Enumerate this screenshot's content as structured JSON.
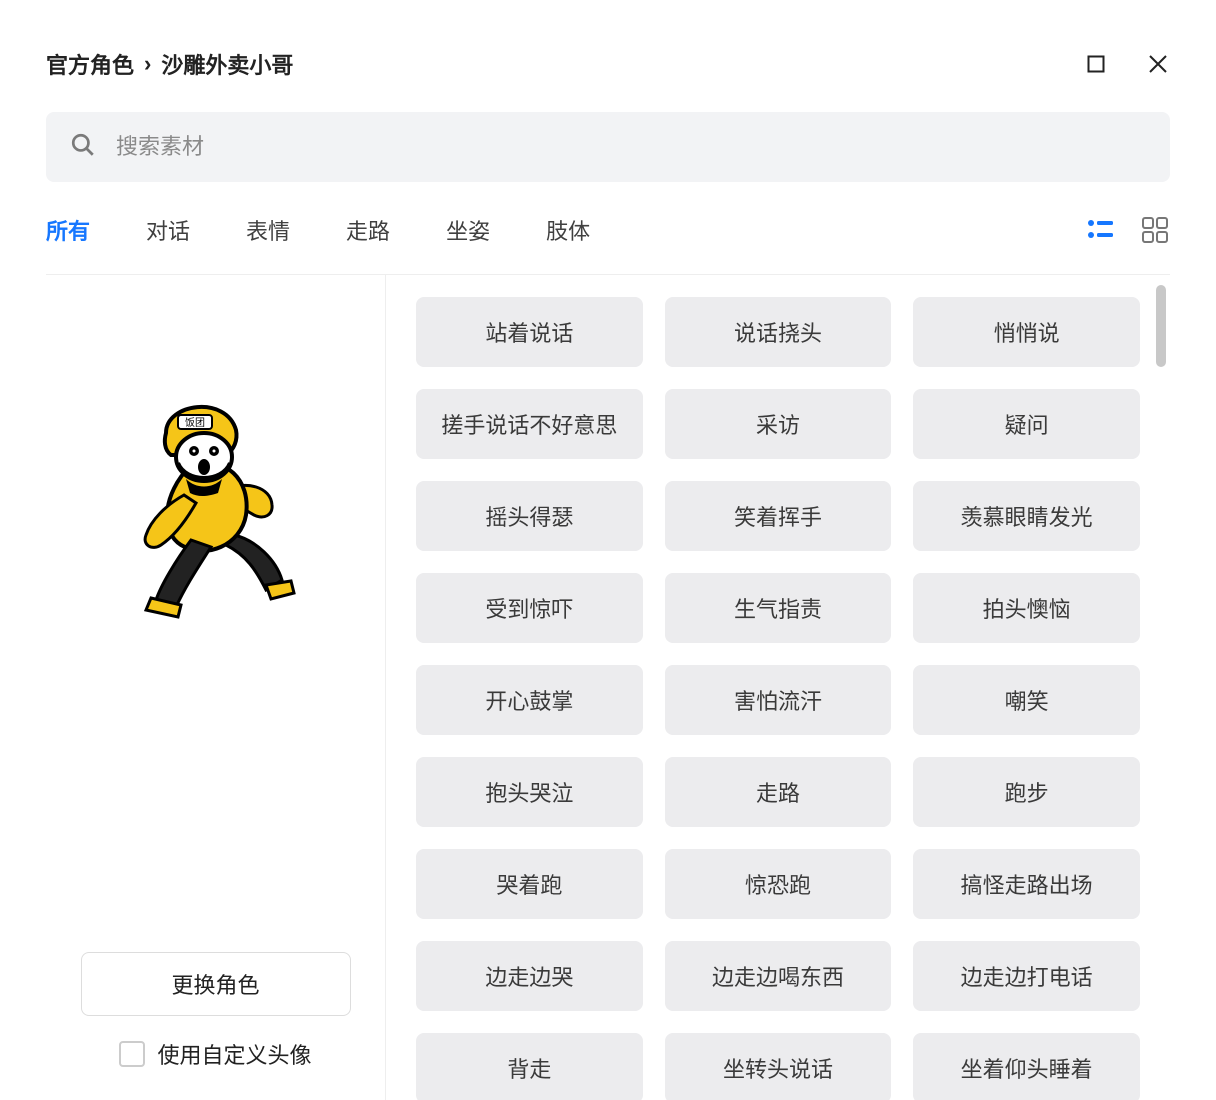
{
  "breadcrumb": {
    "parent": "官方角色",
    "sep": "›",
    "current": "沙雕外卖小哥"
  },
  "search": {
    "placeholder": "搜索素材"
  },
  "tabs": [
    {
      "label": "所有",
      "active": true
    },
    {
      "label": "对话",
      "active": false
    },
    {
      "label": "表情",
      "active": false
    },
    {
      "label": "走路",
      "active": false
    },
    {
      "label": "坐姿",
      "active": false
    },
    {
      "label": "肢体",
      "active": false
    }
  ],
  "colors": {
    "accent": "#1677ff",
    "tile_bg": "#ececee",
    "brand_yellow": "#f5c518"
  },
  "left": {
    "change_role_label": "更换角色",
    "checkbox_label": "使用自定义头像",
    "helmet_text": "饭团"
  },
  "assets": [
    "站着说话",
    "说话挠头",
    "悄悄说",
    "搓手说话不好意思",
    "采访",
    "疑问",
    "摇头得瑟",
    "笑着挥手",
    "羡慕眼睛发光",
    "受到惊吓",
    "生气指责",
    "拍头懊恼",
    "开心鼓掌",
    "害怕流汗",
    "嘲笑",
    "抱头哭泣",
    "走路",
    "跑步",
    "哭着跑",
    "惊恐跑",
    "搞怪走路出场",
    "边走边哭",
    "边走边喝东西",
    "边走边打电话",
    "背走",
    "坐转头说话",
    "坐着仰头睡着"
  ]
}
